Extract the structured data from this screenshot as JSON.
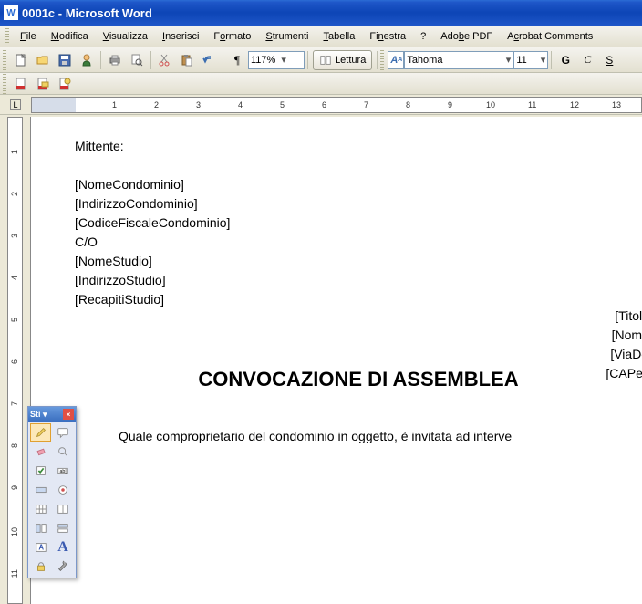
{
  "title": "0001c - Microsoft Word",
  "menu": {
    "file": "File",
    "modifica": "Modifica",
    "visualizza": "Visualizza",
    "inserisci": "Inserisci",
    "formato": "Formato",
    "strumenti": "Strumenti",
    "tabella": "Tabella",
    "finestra": "Finestra",
    "help": "?",
    "adobepdf": "Adobe PDF",
    "acrobat": "Acrobat Comments"
  },
  "toolbar1": {
    "zoom": "117%",
    "lettura": "Lettura",
    "font_label": "A",
    "font_name": "Tahoma",
    "font_size": "11",
    "bold": "G",
    "italic": "C",
    "underline": "S"
  },
  "ruler": {
    "corner": "L"
  },
  "document": {
    "mittente": "Mittente:",
    "line1": "[NomeCondominio]",
    "line2": "[IndirizzoCondominio]",
    "line3": "[CodiceFiscaleCondominio]",
    "line4": "C/O",
    "line5": "[NomeStudio]",
    "line6": "[IndirizzoStudio]",
    "line7": "[RecapitiStudio]",
    "r1": "[TitoloD",
    "r2": "[NomeD",
    "r3": "[ViaDest",
    "r4": "[CAPeCit",
    "heading": "CONVOCAZIONE DI ASSEMBLEA",
    "body": "Quale comproprietario del condominio in oggetto, è invitata ad interve"
  },
  "toolbox": {
    "title": "Sti"
  }
}
